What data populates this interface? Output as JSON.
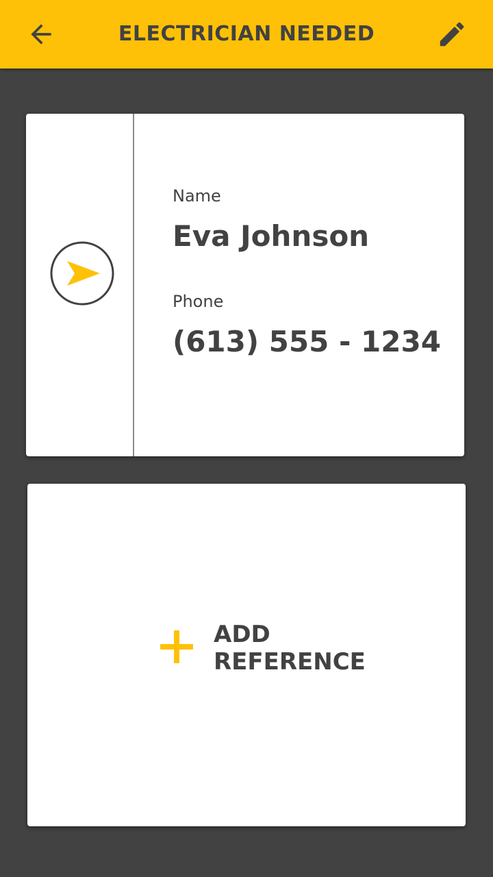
{
  "appbar": {
    "title": "ELECTRICIAN NEEDED",
    "back_icon": "arrow-left-icon",
    "edit_icon": "pencil-icon",
    "background": "#FFC107"
  },
  "contact": {
    "send_icon": "send-icon",
    "name_label": "Name",
    "name_value": "Eva Johnson",
    "phone_label": "Phone",
    "phone_value": "(613) 555 - 1234"
  },
  "reference": {
    "add_icon": "plus-icon",
    "label_line1": "ADD",
    "label_line2": "REFERENCE"
  },
  "colors": {
    "accent": "#FFC107",
    "text": "#424242",
    "background": "#424242",
    "card": "#FFFFFF"
  }
}
